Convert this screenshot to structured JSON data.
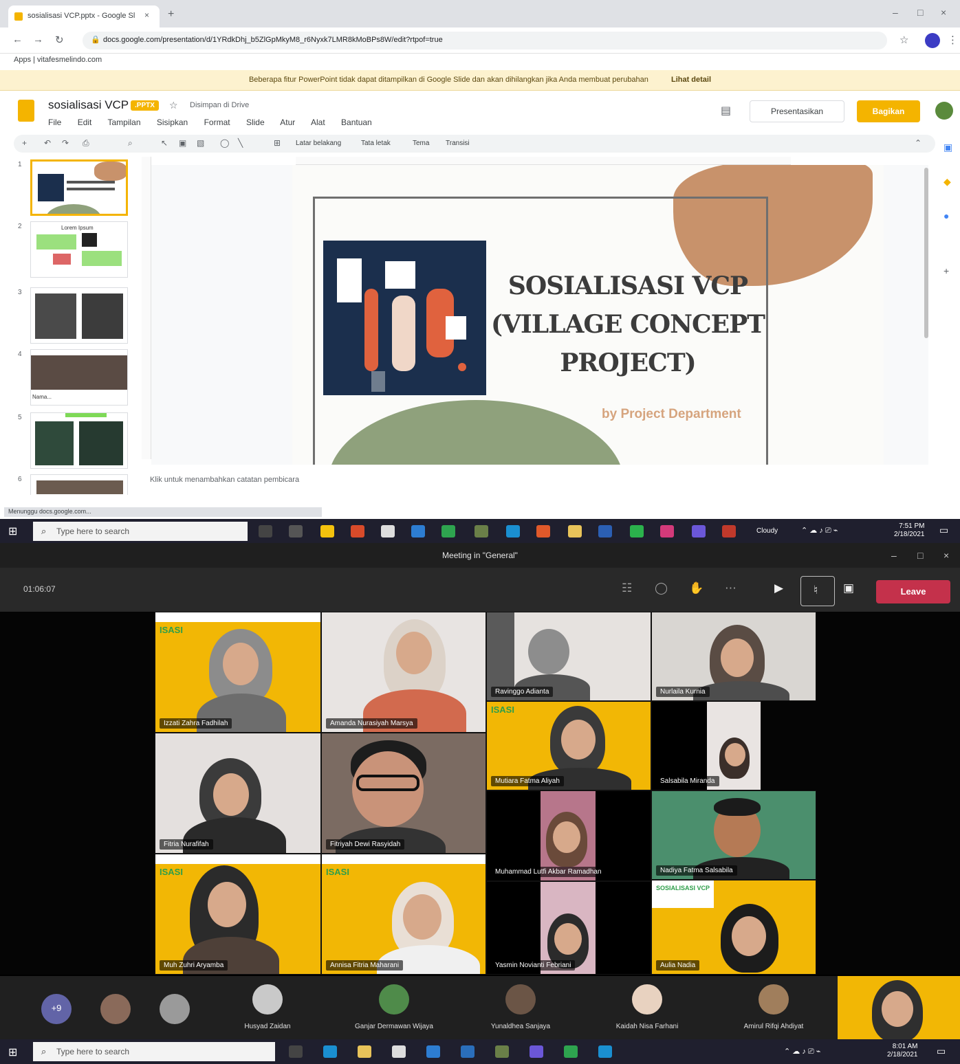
{
  "browser": {
    "tab_title": "sosialisasi VCP.pptx - Google Sl",
    "tab_close": "×",
    "tab_new": "+",
    "window_controls": [
      "–",
      "□",
      "×"
    ],
    "nav": {
      "back": "←",
      "forward": "→",
      "reload": "↻"
    },
    "url": "docs.google.com/presentation/d/1YRdkDhj_b5ZlGpMkyM8_r6Nyxk7LMR8kMoBPs8W/edit?rtpof=true",
    "bookmark": "Apps   |   vitafesmelindo.com",
    "banner_text": "Beberapa fitur PowerPoint tidak dapat ditampilkan di Google Slide dan akan dihilangkan jika Anda membuat perubahan",
    "banner_link": "Lihat detail"
  },
  "slides_app": {
    "doc_title": "sosialisasi VCP",
    "format_badge": ".PPTX",
    "drive_status": "Disimpan di Drive",
    "menu": [
      "File",
      "Edit",
      "Tampilan",
      "Sisipkan",
      "Format",
      "Slide",
      "Atur",
      "Alat",
      "Bantuan"
    ],
    "present_label": "Presentasikan",
    "share_label": "Bagikan",
    "toolbar_items": [
      "Latar belakang",
      "Tata letak",
      "Tema",
      "Transisi"
    ],
    "notes_placeholder": "Klik untuk menambahkan catatan pembicara",
    "status_url": "Menunggu docs.google.com...",
    "thumb_numbers": [
      "1",
      "2",
      "3",
      "4",
      "5",
      "6"
    ],
    "thumb_captions": {
      "t2": "Lorem Ipsum",
      "t4": "Nama..."
    }
  },
  "slide": {
    "title_lines": [
      "SOSIALISASI VCP",
      "(VILLAGE CONCEPT",
      "PROJECT)"
    ],
    "subtitle": "by Project Department"
  },
  "taskbar1": {
    "search_placeholder": "Type here to search",
    "tray_time": "7:51 PM",
    "tray_date": "2/18/2021",
    "tray_weather": "Cloudy"
  },
  "teams": {
    "window_title": "Meeting in \"General\"",
    "timer": "01:06:07",
    "leave_label": "Leave",
    "tiles": [
      {
        "name": "Izzati Zahra Fadhilah"
      },
      {
        "name": "Amanda Nurasiyah Marsya"
      },
      {
        "name": "Ravinggo Adianta"
      },
      {
        "name": "Nurlaila Kurnia"
      },
      {
        "name": "Fitria Nurafifah"
      },
      {
        "name": "Fitriyah Dewi Rasyidah"
      },
      {
        "name": "Mutiara Fatma Aliyah"
      },
      {
        "name": "Muh Zuhri Aryamba"
      },
      {
        "name": "Annisa Fitria Maharani"
      },
      {
        "name": "Muhammad Lutfi Akbar Ramadhan"
      },
      {
        "name": "Nadiya Fatma Salsabila"
      },
      {
        "name": "Salsabila Miranda"
      },
      {
        "name": "Yasmin Novianti Febriani"
      },
      {
        "name": "Aulia Nadia"
      }
    ],
    "tile_banner_text": "ISASI",
    "tile_banner_text2": "SOSIALISASI VCP",
    "participants": [
      {
        "name": "Husyad Zaidan"
      },
      {
        "name": "Ganjar Dermawan Wijaya"
      },
      {
        "name": "Yunaldhea Sanjaya"
      },
      {
        "name": "Kaidah Nisa Farhani"
      },
      {
        "name": "Amirul Rifqi Ahdiyat"
      }
    ],
    "more_label": "+9"
  },
  "taskbar2": {
    "search_placeholder": "Type here to search",
    "tray_time": "8:01 AM",
    "tray_date": "2/18/2021"
  },
  "colors": {
    "slides_yellow": "#f4b400",
    "teams_leave": "#c4314b",
    "slide_peach": "#c8926b",
    "slide_sage": "#8fa17c",
    "slide_navy": "#1b2f4d",
    "tile_yellow": "#f2b705"
  }
}
